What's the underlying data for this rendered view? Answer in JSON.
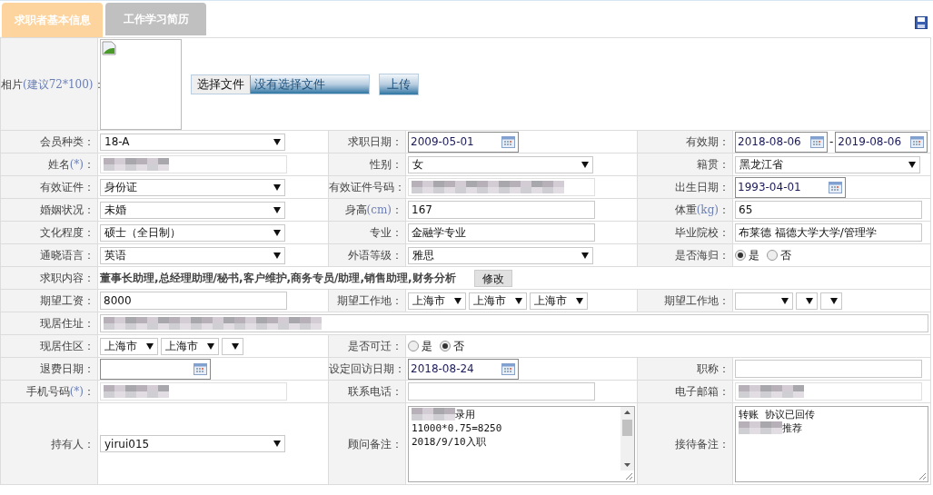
{
  "tabs": [
    {
      "label": "求职者基本信息",
      "selected": true
    },
    {
      "label": "工作学习简历",
      "selected": false
    }
  ],
  "photo_row": {
    "label": "相片",
    "note": "(建议72*100)",
    "tail": "：",
    "choose_button": "选择文件",
    "file_status": "没有选择文件",
    "upload_button": "上传"
  },
  "rows": [
    {
      "cells": [
        {
          "label": "会员种类：",
          "field": {
            "kind": "select",
            "value": "18-A"
          }
        },
        {
          "label": "求职日期：",
          "field": {
            "kind": "date",
            "value": "2009-05-01"
          }
        },
        {
          "label": "有效期：",
          "field": {
            "kind": "date_range",
            "from": "2018-08-06",
            "separator": "-",
            "to": "2019-08-06"
          }
        }
      ]
    },
    {
      "cells": [
        {
          "label": "姓名",
          "note": "(*)",
          "tail": "：",
          "field": {
            "kind": "blurred"
          }
        },
        {
          "label": "性别：",
          "field": {
            "kind": "select",
            "value": "女"
          }
        },
        {
          "label": "籍贯：",
          "field": {
            "kind": "select",
            "value": "黑龙江省"
          }
        }
      ]
    },
    {
      "cells": [
        {
          "label": "有效证件：",
          "field": {
            "kind": "select",
            "value": "身份证"
          }
        },
        {
          "label": "有效证件号码：",
          "field": {
            "kind": "blurred"
          }
        },
        {
          "label": "出生日期：",
          "field": {
            "kind": "date",
            "value": "1993-04-01"
          }
        }
      ]
    },
    {
      "cells": [
        {
          "label": "婚姻状况：",
          "field": {
            "kind": "select",
            "value": "未婚"
          }
        },
        {
          "label": "身高",
          "note": "(cm)",
          "tail": "：",
          "field": {
            "kind": "input",
            "value": "167"
          }
        },
        {
          "label": "体重",
          "note": "(kg)",
          "tail": "：",
          "field": {
            "kind": "input",
            "value": "65"
          }
        }
      ]
    },
    {
      "cells": [
        {
          "label": "文化程度：",
          "field": {
            "kind": "select",
            "value": "硕士（全日制）"
          }
        },
        {
          "label": "专业：",
          "field": {
            "kind": "input",
            "value": "金融学专业"
          }
        },
        {
          "label": "毕业院校：",
          "field": {
            "kind": "input",
            "value": "布莱德 福德大学大学/管理学"
          }
        }
      ]
    },
    {
      "cells": [
        {
          "label": "通晓语言：",
          "field": {
            "kind": "select",
            "value": "英语"
          }
        },
        {
          "label": "外语等级：",
          "field": {
            "kind": "select",
            "value": "雅思"
          }
        },
        {
          "label": "是否海归：",
          "field": {
            "kind": "radio",
            "options": [
              {
                "label": "是",
                "selected": true
              },
              {
                "label": "否",
                "selected": false
              }
            ]
          }
        }
      ]
    },
    {
      "cells": [
        {
          "label": "求职内容：",
          "field": {
            "kind": "text_button",
            "text": "董事长助理,总经理助理/秘书,客户维护,商务专员/助理,销售助理,财务分析",
            "button": "修改"
          }
        }
      ]
    },
    {
      "cells": [
        {
          "label": "期望工资：",
          "field": {
            "kind": "input",
            "value": "8000"
          }
        },
        {
          "label": "期望工作地：",
          "field": {
            "kind": "selects",
            "items": [
              {
                "kind": "value",
                "value": "上海市"
              },
              {
                "kind": "value",
                "value": "上海市"
              },
              {
                "kind": "value",
                "value": "上海市"
              }
            ]
          }
        },
        {
          "label": "期望工作地：",
          "field": {
            "kind": "selects",
            "items": [
              {
                "kind": "blank"
              },
              {
                "kind": "blank"
              },
              {
                "kind": "blank"
              }
            ]
          }
        }
      ]
    },
    {
      "cells": [
        {
          "label": "现居住址：",
          "field": {
            "kind": "blurred_wide"
          }
        }
      ]
    },
    {
      "cells": [
        {
          "label": "现居住区：",
          "field": {
            "kind": "selects",
            "items": [
              {
                "kind": "value",
                "value": "上海市"
              },
              {
                "kind": "value",
                "value": "上海市"
              },
              {
                "kind": "blank"
              }
            ]
          }
        },
        {
          "label": "是否可迁：",
          "field": {
            "kind": "radio",
            "options": [
              {
                "label": "是",
                "selected": false
              },
              {
                "label": "否",
                "selected": true
              }
            ]
          }
        }
      ]
    },
    {
      "cells": [
        {
          "label": "退费日期：",
          "field": {
            "kind": "date"
          }
        },
        {
          "label": "设定回访日期：",
          "field": {
            "kind": "date",
            "value": "2018-08-24"
          }
        },
        {
          "label": "职称：",
          "field": {
            "kind": "input"
          }
        }
      ]
    },
    {
      "cells": [
        {
          "label": "手机号码",
          "note": "(*)",
          "tail": "：",
          "field": {
            "kind": "blurred"
          }
        },
        {
          "label": "联系电话：",
          "field": {
            "kind": "input"
          }
        },
        {
          "label": "电子邮箱：",
          "field": {
            "kind": "blurred"
          }
        }
      ]
    },
    {
      "cells": [
        {
          "label": "持有人：",
          "field": {
            "kind": "select",
            "value": "yirui015"
          }
        },
        {
          "label": "顾问备注：",
          "field": {
            "kind": "textarea",
            "scrollbar": true,
            "lines": [
              {
                "blurred_prefix": true,
                "text": "录用"
              },
              {
                "text": "11000*0.75=8250"
              },
              {
                "text": "2018/9/10入职"
              }
            ]
          }
        },
        {
          "label": "接待备注：",
          "field": {
            "kind": "textarea",
            "scrollbar": false,
            "lines": [
              {
                "text": "转账 协议已回传"
              },
              {
                "blurred_prefix": true,
                "text": "推荐"
              }
            ]
          }
        }
      ]
    }
  ]
}
